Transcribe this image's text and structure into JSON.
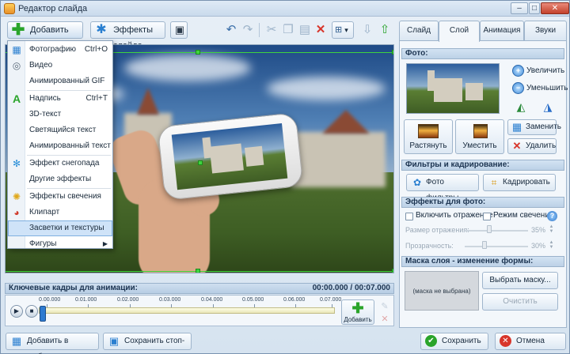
{
  "window": {
    "title": "Редактор слайда",
    "minimize": "–",
    "maximize": "□",
    "close": "✕"
  },
  "toolbar": {
    "add_layer_label": "Добавить слой",
    "slide_effects_label": "Эффекты слайда",
    "zoom_arrow": "▾"
  },
  "menu": {
    "items": [
      {
        "label": "Фотографию",
        "shortcut": "Ctrl+O",
        "icon": "photo-icon"
      },
      {
        "label": "Видео",
        "shortcut": "",
        "icon": "video-icon"
      },
      {
        "label": "Анимированный GIF",
        "shortcut": "",
        "icon": ""
      },
      {
        "label": "Надпись",
        "shortcut": "Ctrl+T",
        "icon": "text-icon"
      },
      {
        "label": "3D-текст",
        "shortcut": "",
        "icon": ""
      },
      {
        "label": "Светящийся текст",
        "shortcut": "",
        "icon": ""
      },
      {
        "label": "Анимированный текст",
        "shortcut": "",
        "icon": ""
      },
      {
        "label": "Эффект снегопада",
        "shortcut": "",
        "icon": "snowflake-icon"
      },
      {
        "label": "Другие эффекты",
        "shortcut": "",
        "icon": ""
      },
      {
        "label": "Эффекты свечения",
        "shortcut": "",
        "icon": "glow-icon"
      },
      {
        "label": "Клипарт",
        "shortcut": "",
        "icon": "clipart-icon"
      },
      {
        "label": "Засветки и текстуры",
        "shortcut": "",
        "icon": ""
      },
      {
        "label": "Фигуры",
        "shortcut": "",
        "icon": ""
      }
    ],
    "submenu_arrow": "▶",
    "selected_index": 11
  },
  "timeline": {
    "header": "Ключевые кадры для анимации:",
    "time": "00:00.000 / 00:07.000",
    "ticks": [
      "0.00.000",
      "0.01.000",
      "0.02.000",
      "0.03.000",
      "0.04.000",
      "0.05.000",
      "0.06.000",
      "0.07.000"
    ],
    "add_label": "Добавить",
    "play": "▶",
    "stop": "■",
    "marker_position": 0.0
  },
  "bottom": {
    "add_template_label": "Добавить в шаблоны",
    "save_frame_label": "Сохранить стоп-кадр",
    "save_label": "Сохранить",
    "cancel_label": "Отмена"
  },
  "tabs": [
    "Слайд",
    "Слой",
    "Анимация",
    "Звуки"
  ],
  "active_tab": 1,
  "panel": {
    "photo_header": "Фото:",
    "zoom_in": "Увеличить",
    "zoom_out": "Уменьшить",
    "stretch": "Растянуть",
    "fit": "Уместить",
    "replace": "Заменить",
    "delete": "Удалить",
    "filters_header": "Фильтры и кадрирование:",
    "photo_filters": "Фото фильтры",
    "crop": "Кадрировать",
    "effects_header": "Эффекты для фото:",
    "reflection_label": "Включить отражение",
    "glow_label": "Режим свечения",
    "help": "?",
    "reflection_size_label": "Размер отражения:",
    "reflection_size_value": "35%",
    "transparency_label": "Прозрачность:",
    "transparency_value": "30%",
    "mask_header": "Маска слоя - изменение формы:",
    "mask_placeholder": "(маска не выбрана)",
    "choose_mask": "Выбрать маску...",
    "clear": "Очистить"
  },
  "colors": {
    "accent": "#3f8ad8",
    "selection": "#3fd43f",
    "menu_highlight": "#cfe3f8"
  }
}
